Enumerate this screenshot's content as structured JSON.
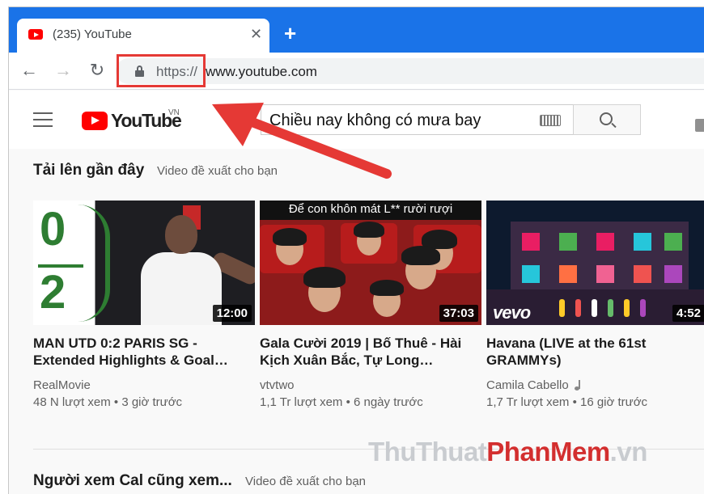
{
  "browser": {
    "tab_title": "(235) YouTube",
    "close_glyph": "✕",
    "new_tab_glyph": "+",
    "url_scheme": "https://",
    "url_host": "www.youtube.com",
    "back_glyph": "←",
    "forward_glyph": "→",
    "reload_glyph": "↻"
  },
  "masthead": {
    "logo_word": "YouTube",
    "logo_country": "VN",
    "search_value": "Chiều nay không có mưa bay"
  },
  "sections": [
    {
      "title": "Tải lên gần đây",
      "subtitle": "Video đề xuất cho bạn"
    },
    {
      "title": "Người xem Cal cũng xem...",
      "subtitle": "Video đề xuất cho bạn"
    }
  ],
  "videos": [
    {
      "title": "MAN UTD 0:2 PARIS SG - Extended Highlights & Goal…",
      "channel": "RealMovie",
      "meta": "48 N lượt xem • 3 giờ trước",
      "duration": "12:00",
      "thumb_digits": [
        "0",
        "2"
      ]
    },
    {
      "title": "Gala Cười 2019 | Bố Thuê - Hài Kịch Xuân Bắc, Tự Long…",
      "channel": "vtvtwo",
      "meta": "1,1 Tr lượt xem • 6 ngày trước",
      "duration": "37:03",
      "thumb_caption": "Để con khôn mát L** rười rượi"
    },
    {
      "title": "Havana (LIVE at the 61st GRAMMYs)",
      "channel": "Camila Cabello",
      "meta": "1,7 Tr lượt xem • 16 giờ trước",
      "duration": "4:52",
      "thumb_logo": "vevo"
    }
  ],
  "watermark": {
    "part1": "ThuThuat",
    "part2": "PhanMem",
    "part3": ".vn"
  },
  "colors": {
    "accent": "#1a73e8",
    "youtube_red": "#ff0000",
    "highlight": "#e53935"
  }
}
